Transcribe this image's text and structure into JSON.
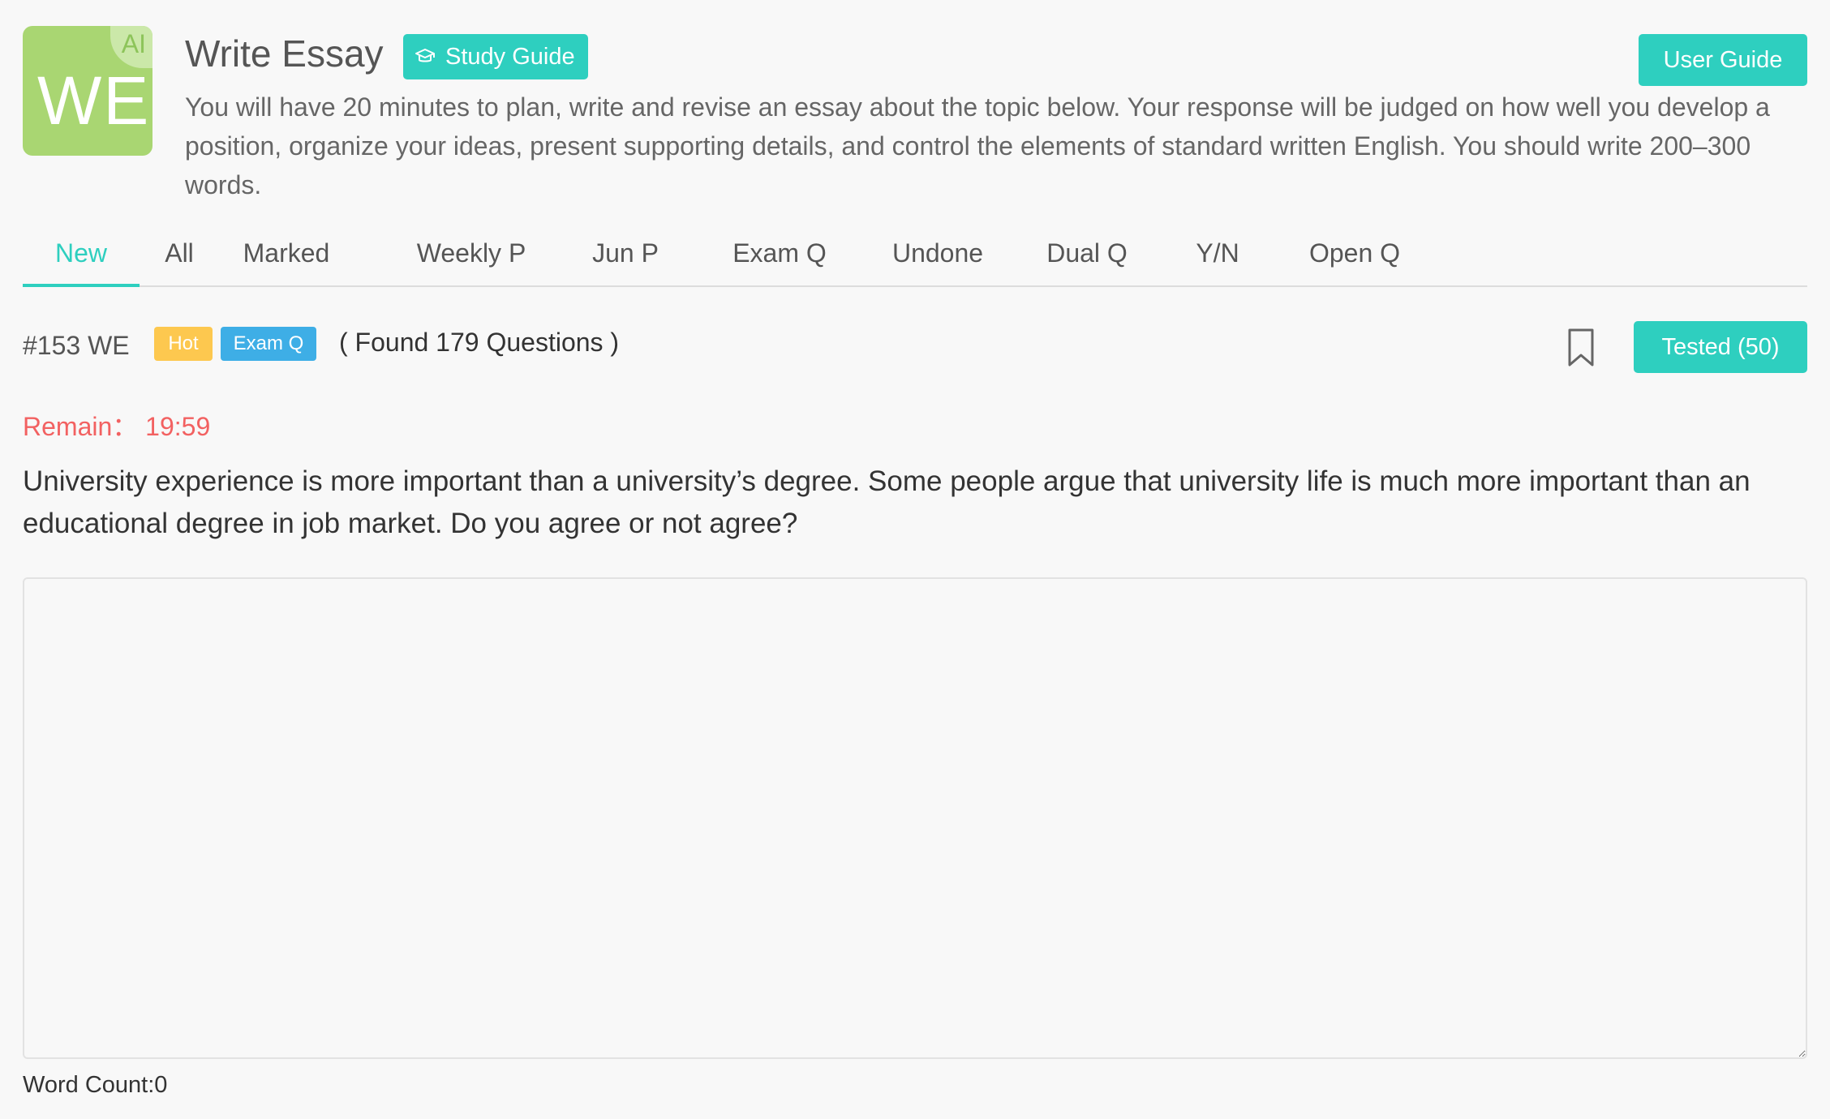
{
  "header": {
    "logo_text": "WE",
    "logo_badge": "AI",
    "title": "Write Essay",
    "study_guide_label": "Study Guide",
    "user_guide_label": "User Guide",
    "instructions": "You will have 20 minutes to plan, write and revise an essay about the topic below. Your response will be judged on how well you develop a position, organize your ideas, present supporting details, and control the elements of standard written English. You should write 200–300 words."
  },
  "tabs": [
    {
      "label": "New",
      "active": true
    },
    {
      "label": "All"
    },
    {
      "label": "Marked"
    },
    {
      "label": "Weekly P"
    },
    {
      "label": "Jun P"
    },
    {
      "label": "Exam Q"
    },
    {
      "label": "Undone"
    },
    {
      "label": "Dual Q"
    },
    {
      "label": "Y/N"
    },
    {
      "label": "Open Q"
    }
  ],
  "question": {
    "number": "#153 WE",
    "badges": [
      "Hot",
      "Exam Q"
    ],
    "found": "( Found 179 Questions )",
    "tested_label": "Tested (50)",
    "remain_label": "Remain： 19:59",
    "prompt": "University experience is more important than a university’s degree. Some people argue that university life is much more important than an educational degree in job market. Do you agree or not agree?"
  },
  "editor": {
    "value": "",
    "word_count_label": "Word Count:0"
  },
  "colors": {
    "accent": "#2ecfbf",
    "hot": "#fdc84f",
    "exam": "#3eaee6",
    "remain": "#f26161",
    "logo": "#a9d672"
  },
  "icons": {
    "study_guide": "graduation-cap-icon",
    "bookmark": "bookmark-icon"
  }
}
